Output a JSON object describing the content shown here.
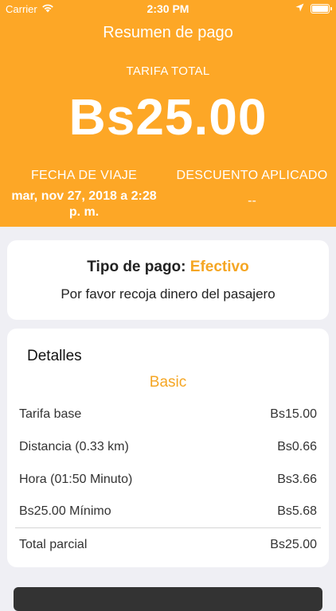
{
  "status_bar": {
    "carrier": "Carrier",
    "time": "2:30 PM"
  },
  "header": {
    "title": "Resumen de pago",
    "fare_label": "TARIFA TOTAL",
    "fare_amount": "Bs25.00",
    "trip_date_label": "FECHA DE VIAJE",
    "trip_date_value": "mar, nov 27, 2018 a 2:28 p. m.",
    "discount_label": "DESCUENTO APLICADO",
    "discount_value": "--"
  },
  "payment": {
    "type_label": "Tipo de pago:",
    "type_value": "Efectivo",
    "message": "Por favor recoja dinero del pasajero"
  },
  "details": {
    "title": "Detalles",
    "plan": "Basic",
    "rows": [
      {
        "label": "Tarifa base",
        "value": "Bs15.00"
      },
      {
        "label": "Distancia (0.33 km)",
        "value": "Bs0.66"
      },
      {
        "label": "Hora (01:50 Minuto)",
        "value": "Bs3.66"
      },
      {
        "label": "Bs25.00 Mínimo",
        "value": "Bs5.68"
      }
    ],
    "subtotal_label": "Total parcial",
    "subtotal_value": "Bs25.00"
  },
  "colors": {
    "header": "#fda726",
    "accent": "#f5a623",
    "background": "#efeff4"
  }
}
